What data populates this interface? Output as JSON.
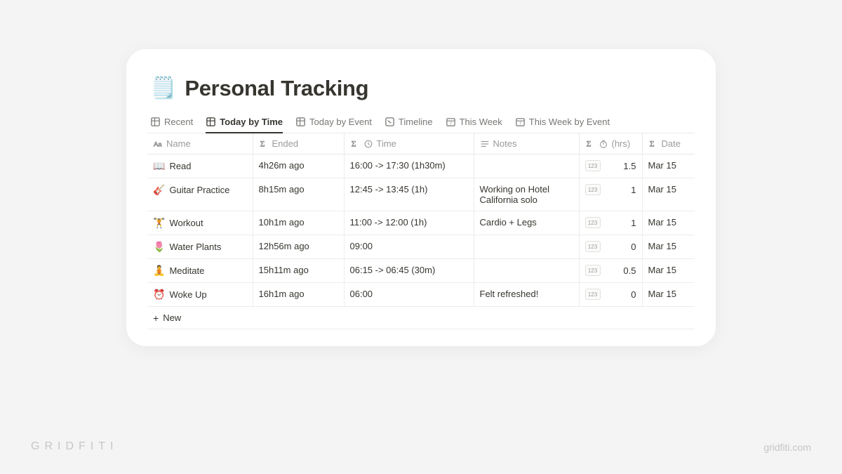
{
  "page": {
    "icon": "🗒️",
    "title": "Personal Tracking"
  },
  "tabs": [
    {
      "label": "Recent",
      "icon": "table",
      "active": false
    },
    {
      "label": "Today by Time",
      "icon": "table",
      "active": true
    },
    {
      "label": "Today by Event",
      "icon": "table",
      "active": false
    },
    {
      "label": "Timeline",
      "icon": "timeline",
      "active": false
    },
    {
      "label": "This Week",
      "icon": "calendar",
      "active": false
    },
    {
      "label": "This Week by Event",
      "icon": "calendar",
      "active": false
    }
  ],
  "columns": {
    "name": {
      "icon": "text",
      "label": "Name"
    },
    "ended": {
      "icon": "sigma",
      "label": "Ended"
    },
    "time": {
      "icon": "sigma",
      "icon2": "clock",
      "label": "Time"
    },
    "notes": {
      "icon": "lines",
      "label": "Notes"
    },
    "hrs": {
      "icon": "sigma",
      "icon2": "stopwatch",
      "label": "(hrs)"
    },
    "date": {
      "icon": "sigma",
      "label": "Date"
    }
  },
  "rows": [
    {
      "emoji": "📖",
      "name": "Read",
      "ended": "4h26m ago",
      "time": "16:00 ->  17:30 (1h30m)",
      "notes": "",
      "hrs": "1.5",
      "date": "Mar 15"
    },
    {
      "emoji": "🎸",
      "name": "Guitar Practice",
      "ended": "8h15m ago",
      "time": "12:45 ->  13:45 (1h)",
      "notes": "Working on Hotel California solo",
      "hrs": "1",
      "date": "Mar 15"
    },
    {
      "emoji": "🏋️",
      "name": "Workout",
      "ended": "10h1m ago",
      "time": "11:00 ->  12:00 (1h)",
      "notes": "Cardio + Legs",
      "hrs": "1",
      "date": "Mar 15"
    },
    {
      "emoji": "🌷",
      "name": "Water Plants",
      "ended": "12h56m ago",
      "time": "09:00",
      "notes": "",
      "hrs": "0",
      "date": "Mar 15"
    },
    {
      "emoji": "🧘",
      "name": "Meditate",
      "ended": "15h11m ago",
      "time": "06:15 ->  06:45 (30m)",
      "notes": "",
      "hrs": "0.5",
      "date": "Mar 15"
    },
    {
      "emoji": "⏰",
      "name": "Woke Up",
      "ended": "16h1m ago",
      "time": "06:00",
      "notes": "Felt refreshed!",
      "hrs": "0",
      "date": "Mar 15"
    }
  ],
  "newRow": {
    "label": "New"
  },
  "hrsBadge": "123",
  "footer": {
    "left": "GRIDFITI",
    "right": "gridfiti.com"
  }
}
